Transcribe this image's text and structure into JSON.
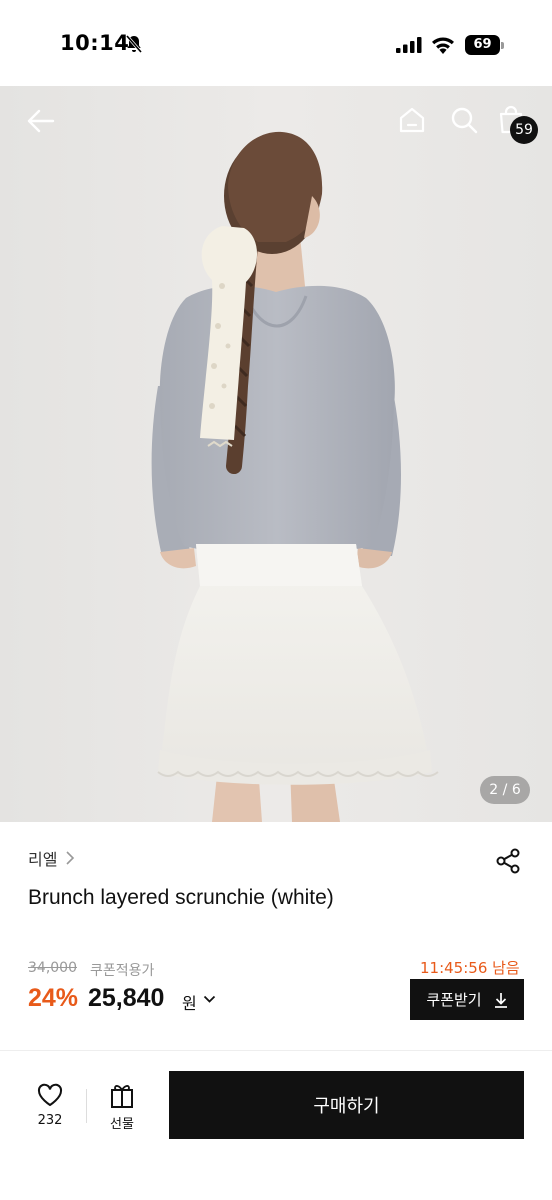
{
  "status_bar": {
    "time": "10:14",
    "battery": "69",
    "icons": [
      "bell-off-icon",
      "signal-icon",
      "wifi-icon",
      "battery-icon"
    ]
  },
  "top_nav": {
    "icons": [
      "back-arrow-icon",
      "home-icon",
      "search-icon",
      "shopping-bag-icon"
    ],
    "cart_badge": "59"
  },
  "gallery": {
    "current": "2",
    "separator": "/",
    "total": "6"
  },
  "product": {
    "brand": "리엘",
    "title": "Brunch layered scrunchie (white)",
    "original_price": "34,000",
    "coupon_price_label": "쿠폰적용가",
    "discount_rate": "24%",
    "sale_price": "25,840",
    "currency_unit": "원",
    "countdown": "11:45:56 남음",
    "coupon_button_label": "쿠폰받기"
  },
  "bottom_bar": {
    "like_count": "232",
    "gift_label": "선물",
    "buy_label": "구매하기"
  },
  "colors": {
    "accent": "#e85a1a",
    "primary_dark": "#111111",
    "muted_text": "#999999"
  }
}
